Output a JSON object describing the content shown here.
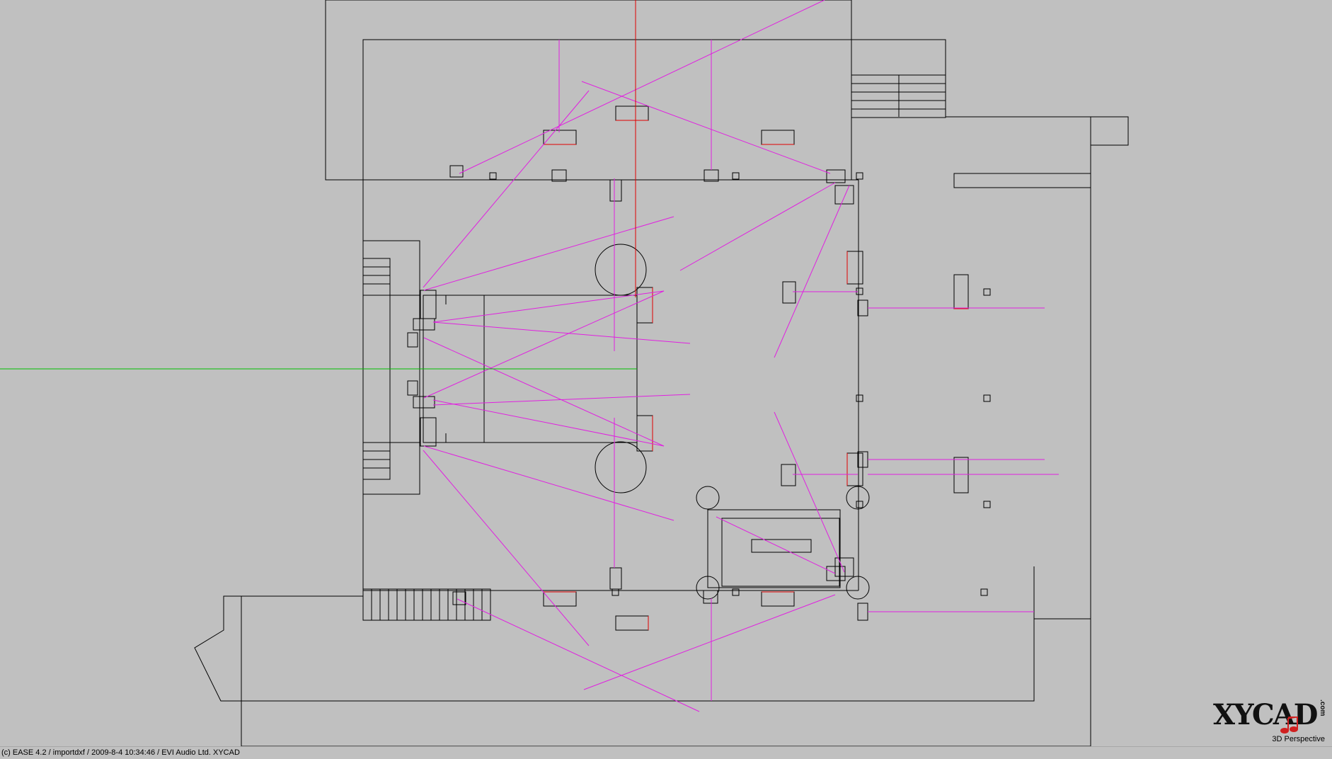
{
  "viewport": {
    "view_mode": "3D Perspective"
  },
  "status_bar": {
    "text": "(c) EASE 4.2  / importdxf  / 2009-8-4 10:34:46 / EVI Audio Ltd. XYCAD"
  },
  "logo": {
    "text": "XYCAD",
    "suffix": ".com"
  },
  "colors": {
    "background": "#c0c0c0",
    "walls": "#000000",
    "sound_rays": "#e020e0",
    "x_axis": "#00c000",
    "y_axis": "#e00000",
    "speaker_face": "#e00000"
  }
}
